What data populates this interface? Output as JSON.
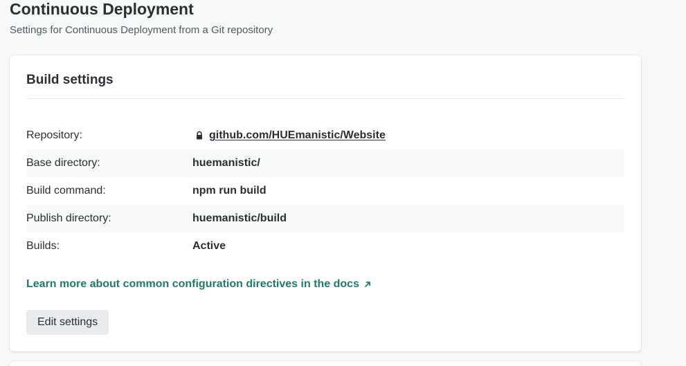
{
  "header": {
    "title": "Continuous Deployment",
    "subtitle": "Settings for Continuous Deployment from a Git repository"
  },
  "card": {
    "title": "Build settings",
    "settings": [
      {
        "label": "Repository:",
        "value": "github.com/HUEmanistic/Website",
        "icon": "lock-icon",
        "link": true
      },
      {
        "label": "Base directory:",
        "value": "huemanistic/"
      },
      {
        "label": "Build command:",
        "value": "npm run build"
      },
      {
        "label": "Publish directory:",
        "value": "huemanistic/build"
      },
      {
        "label": "Builds:",
        "value": "Active"
      }
    ],
    "docs_link": "Learn more about common configuration directives in the docs",
    "docs_link_icon": "external-arrow-icon",
    "edit_button": "Edit settings"
  },
  "colors": {
    "accent_link": "#1d7a6e",
    "text": "#2b2f33",
    "button_bg": "#e9ebed"
  }
}
